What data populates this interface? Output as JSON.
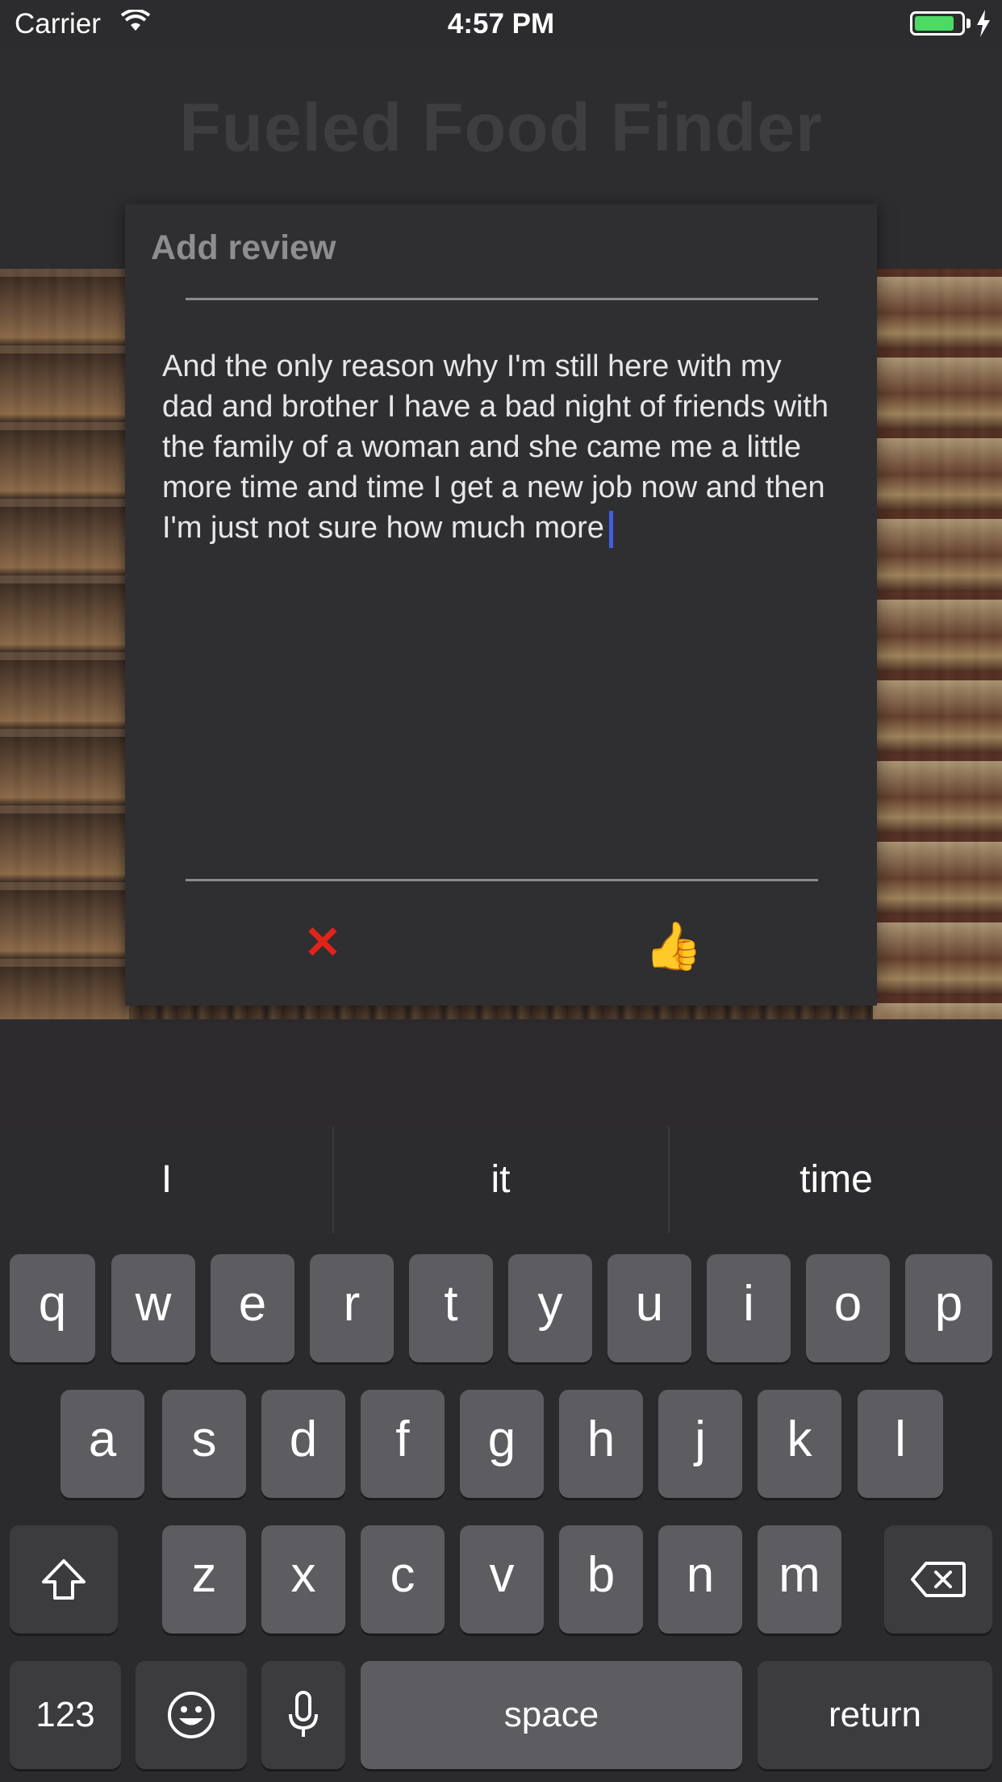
{
  "status_bar": {
    "carrier": "Carrier",
    "time": "4:57 PM",
    "battery_level": 0.85,
    "battery_color": "#4cd964"
  },
  "app": {
    "title": "Fueled Food Finder"
  },
  "dialog": {
    "title": "Add review",
    "review_text": "And the only reason why I'm still here with my dad and brother I have a bad night of friends with the family of a woman and she came me a little more time and time I get a new job now and then I'm just not sure how much more",
    "cancel_icon": "✕",
    "confirm_icon": "👍",
    "cancel_color": "#e0241b",
    "caret_color": "#3f5fe0"
  },
  "keyboard": {
    "suggestions": [
      "I",
      "it",
      "time"
    ],
    "row1": [
      "q",
      "w",
      "e",
      "r",
      "t",
      "y",
      "u",
      "i",
      "o",
      "p"
    ],
    "row2": [
      "a",
      "s",
      "d",
      "f",
      "g",
      "h",
      "j",
      "k",
      "l"
    ],
    "row3": [
      "z",
      "x",
      "c",
      "v",
      "b",
      "n",
      "m"
    ],
    "numbers_key": "123",
    "space_key": "space",
    "return_key": "return"
  }
}
